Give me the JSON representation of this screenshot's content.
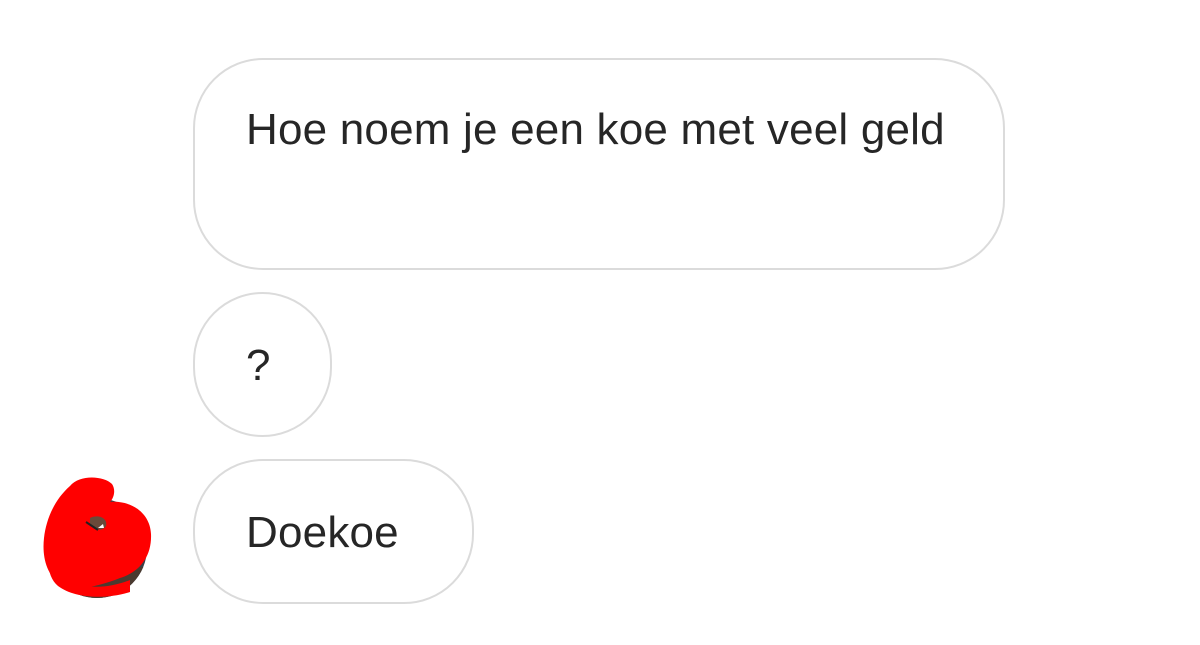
{
  "conversation": {
    "messages": [
      {
        "text": "Hoe noem je een koe met veel geld"
      },
      {
        "text": "?"
      },
      {
        "text": "Doekoe"
      }
    ],
    "avatar": {
      "icon": "redacted-profile-avatar",
      "scribble_color": "#ff0000"
    }
  }
}
